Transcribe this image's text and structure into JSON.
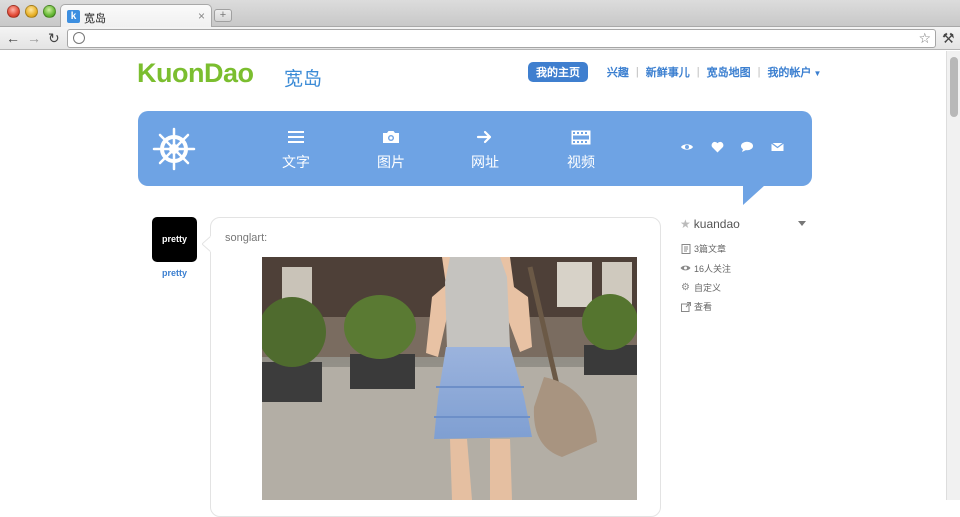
{
  "browser": {
    "tab_title": "宽岛",
    "tab_favicon": "k",
    "new_tab_label": "+",
    "tab_close": "×"
  },
  "logo": {
    "text": "KuonDao",
    "cn": "宽岛"
  },
  "topnav": {
    "home": "我的主页",
    "links": [
      "兴趣",
      "新鲜事儿",
      "宽岛地图",
      "我的帐户"
    ]
  },
  "composer": {
    "types": [
      {
        "label": "文字",
        "icon": "text-lines-icon"
      },
      {
        "label": "图片",
        "icon": "camera-icon"
      },
      {
        "label": "网址",
        "icon": "arrow-right-icon"
      },
      {
        "label": "视频",
        "icon": "film-icon"
      }
    ],
    "actions": [
      "eye-icon",
      "heart-icon",
      "speech-bubble-icon",
      "mail-icon"
    ]
  },
  "post": {
    "avatar_text": "pretty",
    "author": "pretty",
    "source": "songlart:"
  },
  "sidebar": {
    "username": "kuandao",
    "items": [
      {
        "label": "3篇文章",
        "icon": "document-icon"
      },
      {
        "label": "16人关注",
        "icon": "eye-icon"
      },
      {
        "label": "自定义",
        "icon": "gear-icon"
      },
      {
        "label": "查看",
        "icon": "external-link-icon"
      }
    ]
  },
  "colors": {
    "brand_green": "#7bbe2f",
    "accent_blue": "#3f7fcf",
    "panel_blue": "#6ea3e4"
  }
}
